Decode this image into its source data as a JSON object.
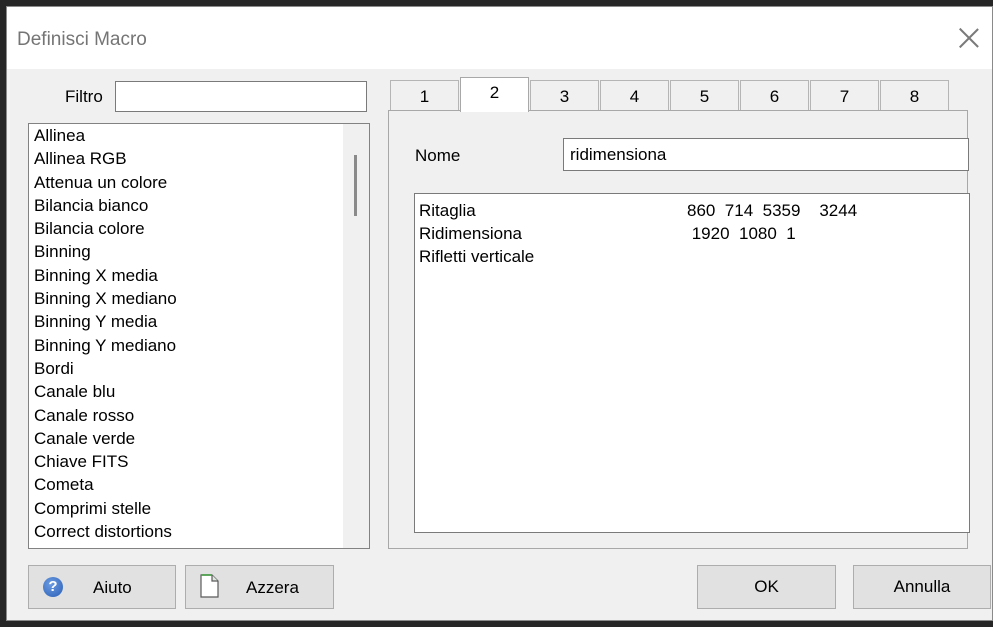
{
  "window": {
    "title": "Definisci Macro"
  },
  "filter": {
    "label": "Filtro",
    "value": ""
  },
  "commands": [
    "Allinea",
    "Allinea RGB",
    "Attenua un colore",
    "Bilancia bianco",
    "Bilancia colore",
    "Binning",
    "Binning X media",
    "Binning X mediano",
    "Binning Y media",
    "Binning Y mediano",
    "Bordi",
    "Canale blu",
    "Canale rosso",
    "Canale verde",
    "Chiave FITS",
    "Cometa",
    "Comprimi stelle",
    "Correct distortions"
  ],
  "tabs": [
    "1",
    "2",
    "3",
    "4",
    "5",
    "6",
    "7",
    "8"
  ],
  "active_tab": "2",
  "macro": {
    "name_label": "Nome",
    "name_value": "ridimensiona",
    "steps": [
      {
        "command": "Ritaglia",
        "params": "860  714  5359    3244"
      },
      {
        "command": "Ridimensiona",
        "params": " 1920  1080  1"
      },
      {
        "command": "Rifletti verticale",
        "params": ""
      }
    ]
  },
  "buttons": {
    "help": "Aiuto",
    "reset": "Azzera",
    "ok": "OK",
    "cancel": "Annulla"
  },
  "icons": {
    "close": "close-icon",
    "help": "help-icon",
    "reset": "document-icon"
  }
}
